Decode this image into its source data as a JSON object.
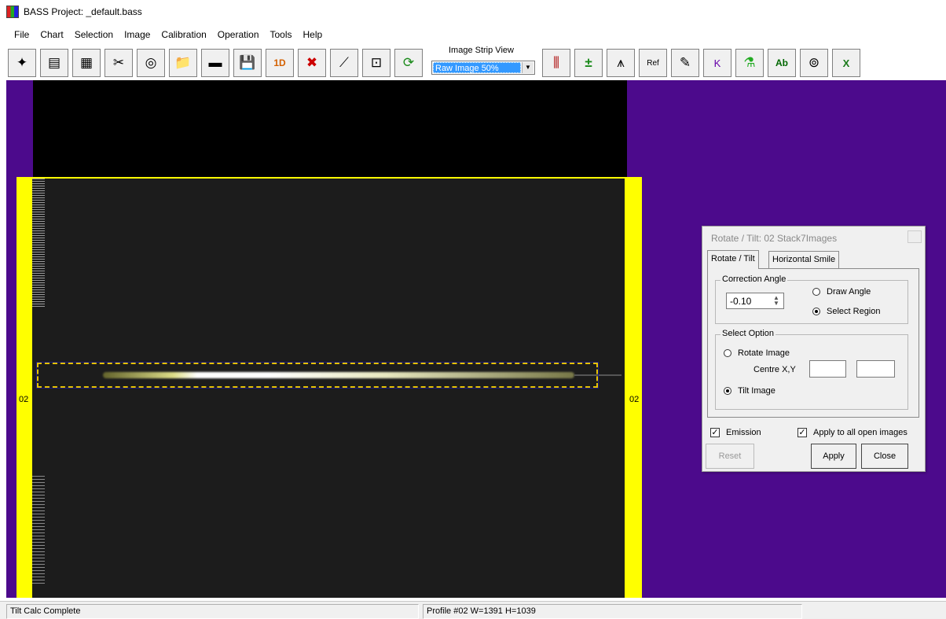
{
  "window": {
    "title": "BASS Project: _default.bass"
  },
  "menu": [
    "File",
    "Chart",
    "Selection",
    "Image",
    "Calibration",
    "Operation",
    "Tools",
    "Help"
  ],
  "toolbar": {
    "buttons_left": [
      {
        "icon": "new-chart-icon",
        "glyph": "✦"
      },
      {
        "icon": "open-chart-icon",
        "glyph": "▤"
      },
      {
        "icon": "save-chart-icon",
        "glyph": "▦"
      },
      {
        "icon": "tools-icon",
        "glyph": "✂"
      },
      {
        "icon": "binoculars-icon",
        "glyph": "◎"
      },
      {
        "icon": "open-folder-icon",
        "glyph": "📁"
      },
      {
        "icon": "film-strip-icon",
        "glyph": "▬"
      },
      {
        "icon": "save-icon",
        "glyph": "💾"
      },
      {
        "icon": "save-1d-icon",
        "glyph": "1D"
      },
      {
        "icon": "delete-icon",
        "glyph": "✖"
      },
      {
        "icon": "line-tool-icon",
        "glyph": "⟋"
      },
      {
        "icon": "crop-icon",
        "glyph": "⊡"
      },
      {
        "icon": "refresh-icon",
        "glyph": "⟳"
      }
    ],
    "strip_label": "Image Strip View",
    "strip_value": "Raw Image 50%",
    "buttons_right": [
      {
        "icon": "calibration-lines-icon",
        "glyph": "⫼"
      },
      {
        "icon": "math-ops-icon",
        "glyph": "±"
      },
      {
        "icon": "compass-icon",
        "glyph": "⩚"
      },
      {
        "icon": "reference-chart-icon",
        "glyph": "Ref"
      },
      {
        "icon": "edit-chart-icon",
        "glyph": "✎"
      },
      {
        "icon": "k-marker-icon",
        "glyph": "K"
      },
      {
        "icon": "flask-icon",
        "glyph": "⚗"
      },
      {
        "icon": "label-ab-icon",
        "glyph": "Ab"
      },
      {
        "icon": "film-reel-icon",
        "glyph": "⊚"
      },
      {
        "icon": "excel-export-icon",
        "glyph": "X"
      }
    ]
  },
  "image": {
    "left_label": "02",
    "right_label": "02"
  },
  "dialog": {
    "title": "Rotate / Tilt: 02 Stack7Images",
    "tabs": [
      "Rotate / Tilt",
      "Horizontal Smile"
    ],
    "correction_group": "Correction Angle",
    "angle_value": "-0.10",
    "draw_angle": "Draw Angle",
    "select_region": "Select Region",
    "select_option_group": "Select Option",
    "rotate_image": "Rotate Image",
    "centre_label": "Centre X,Y",
    "tilt_image": "Tilt Image",
    "emission": "Emission",
    "apply_all": "Apply to all open images",
    "reset": "Reset",
    "apply": "Apply",
    "close": "Close"
  },
  "status": {
    "left": "Tilt Calc Complete",
    "middle": "Profile #02 W=1391 H=1039"
  }
}
